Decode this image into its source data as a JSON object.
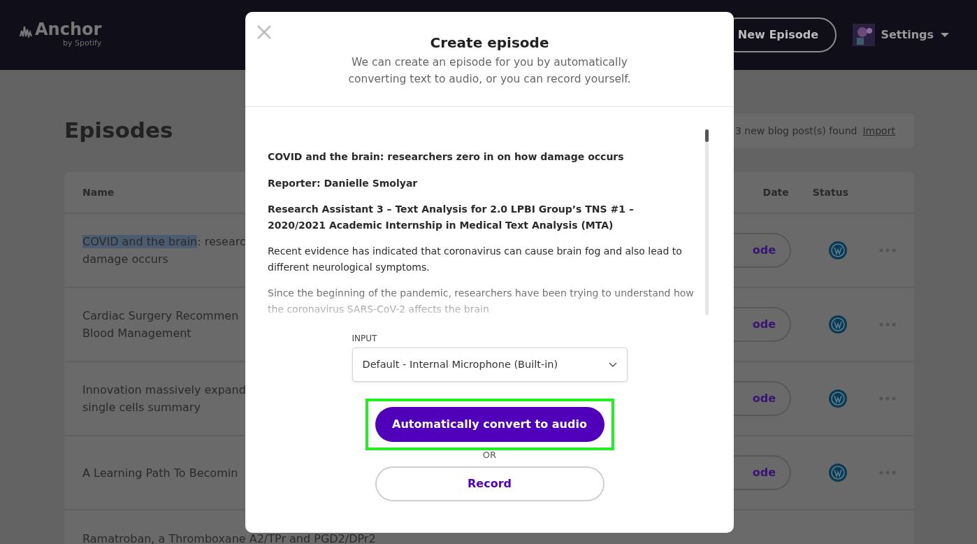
{
  "navbar": {
    "logo": {
      "name": "Anchor",
      "tagline": "by Spotify"
    },
    "new_episode_button": "New Episode",
    "settings": "Settings"
  },
  "page": {
    "title": "Episodes",
    "blog_notice": {
      "text": "3 new blog post(s) found",
      "link": "Import"
    },
    "table": {
      "columns": [
        "Name",
        "Date",
        "Status"
      ],
      "rows": [
        {
          "name_lines": [
            [
              {
                "text": "COVID and the brain",
                "selected": true
              },
              {
                "text": ": researc",
                "selected": false
              }
            ],
            [
              {
                "text": "damage occurs",
                "selected": false
              }
            ]
          ],
          "button": "ode"
        },
        {
          "name_lines": [
            [
              {
                "text": "Cardiac Surgery Recommen",
                "selected": false
              }
            ],
            [
              {
                "text": "Blood Management",
                "selected": false
              }
            ]
          ],
          "button": "ode"
        },
        {
          "name_lines": [
            [
              {
                "text": "Innovation massively expand",
                "selected": false
              }
            ],
            [
              {
                "text": "single cells summary",
                "selected": false
              }
            ]
          ],
          "button": "ode"
        },
        {
          "name_lines": [
            [
              {
                "text": "A Learning Path To Becomin",
                "selected": false
              }
            ]
          ],
          "button": "ode"
        },
        {
          "name_lines": [
            [
              {
                "text": "Ramatroban, a Thromboxane A2/TPr and PGD2/DPr2",
                "selected": false
              }
            ]
          ]
        }
      ]
    }
  },
  "modal": {
    "title": "Create episode",
    "subtitle": "We can create an episode for you by automatically converting text to audio, or you can record yourself.",
    "article": [
      {
        "text": "COVID and the brain: researchers zero in on how damage occurs",
        "bold": true
      },
      {
        "text": "Reporter: Danielle Smolyar",
        "bold": true
      },
      {
        "text": "Research Assistant 3 – Text Analysis for 2.0 LPBI Group’s TNS #1 – 2020/2021 Academic Internship in Medical Text Analysis (MTA)",
        "bold": true
      },
      {
        "text": "Recent evidence has indicated that coronavirus can cause brain fog and also lead to different neurological symptoms.",
        "bold": false
      },
      {
        "text": "Since the beginning of the pandemic, researchers have been trying to understand how the coronavirus SARS-CoV-2 affects the brain",
        "bold": false
      }
    ],
    "input": {
      "label": "INPUT",
      "value": "Default - Internal Microphone (Built-in)"
    },
    "convert_button": {
      "label": "Automatically convert to audio",
      "highlighted": true
    },
    "or": "OR",
    "record_button": "Record"
  }
}
